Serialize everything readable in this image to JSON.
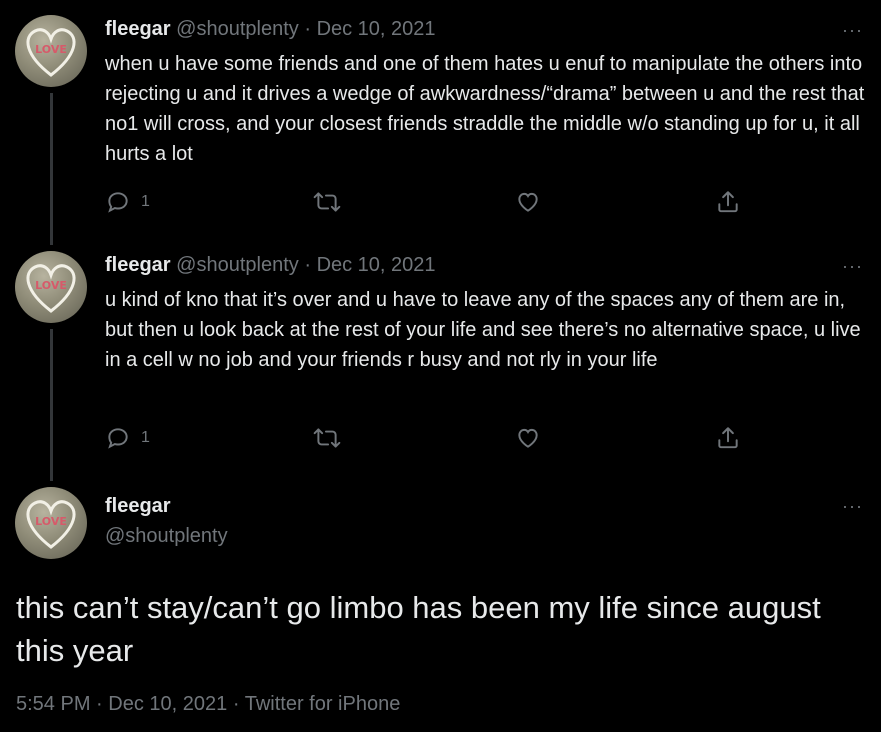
{
  "tweets": [
    {
      "name": "fleegar",
      "handle": "@shoutplenty",
      "date": "Dec 10, 2021",
      "separator": "·",
      "text": "when u have some friends and one of them hates u enuf to manipulate the others into rejecting u and it drives a wedge of awkwardness/“drama” between u and the rest that no1 will cross, and your closest friends straddle the middle w/o standing up for u, it all hurts a lot",
      "reply_count": "1",
      "more_label": "···"
    },
    {
      "name": "fleegar",
      "handle": "@shoutplenty",
      "date": "Dec 10, 2021",
      "separator": "·",
      "text": "u kind of kno that it’s over and u have to leave any of the spaces any of them are in, but then u look back at the rest of your life and see there’s no alternative space, u live in a cell w no job and your friends r busy and not rly in your life",
      "reply_count": "1",
      "more_label": "···"
    }
  ],
  "main_tweet": {
    "name": "fleegar",
    "handle": "@shoutplenty",
    "more_label": "···",
    "text": "this can’t stay/can’t go limbo has been my life since august this year",
    "time": "5:54 PM",
    "date": "Dec 10, 2021",
    "source": "Twitter for iPhone",
    "separator": "·"
  },
  "avatar_label": "LOVE",
  "colors": {
    "background": "#000000",
    "text": "#e7e9ea",
    "secondary": "#71767b",
    "thread_line": "#333639"
  },
  "icons": [
    "reply-icon",
    "retweet-icon",
    "like-icon",
    "share-icon",
    "more-icon"
  ]
}
